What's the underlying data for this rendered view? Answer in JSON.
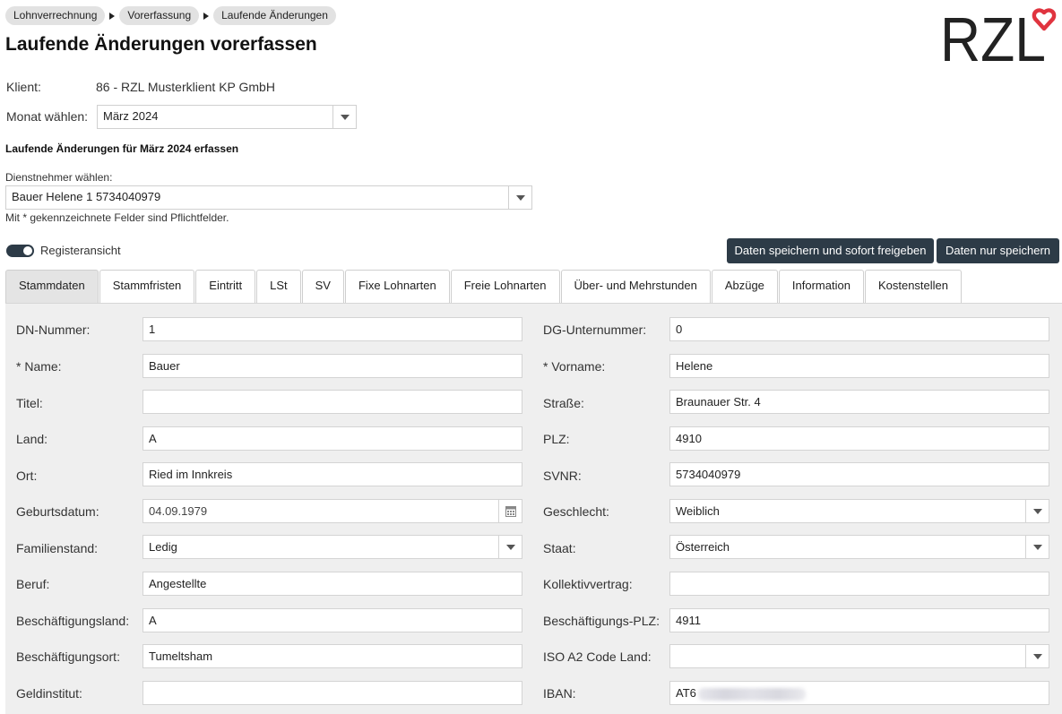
{
  "breadcrumb": [
    "Lohnverrechnung",
    "Vorerfassung",
    "Laufende Änderungen"
  ],
  "page_title": "Laufende Änderungen vorerfassen",
  "logo_text": "RZL",
  "client": {
    "label": "Klient:",
    "value": "86 - RZL Musterklient KP GmbH"
  },
  "month": {
    "label": "Monat wählen:",
    "value": "März 2024"
  },
  "section_heading": "Laufende Änderungen für März 2024 erfassen",
  "employee": {
    "label": "Dienstnehmer wählen:",
    "value": "Bauer Helene 1 5734040979"
  },
  "required_note": "Mit * gekennzeichnete Felder sind Pflichtfelder.",
  "register_toggle": {
    "label": "Registeransicht",
    "on": true
  },
  "buttons": {
    "save_release": "Daten speichern und sofort freigeben",
    "save_only": "Daten nur speichern"
  },
  "tabs": [
    "Stammdaten",
    "Stammfristen",
    "Eintritt",
    "LSt",
    "SV",
    "Fixe Lohnarten",
    "Freie Lohnarten",
    "Über- und Mehrstunden",
    "Abzüge",
    "Information",
    "Kostenstellen"
  ],
  "active_tab": "Stammdaten",
  "fields": {
    "dn_nummer": {
      "label": "DN-Nummer:",
      "value": "1"
    },
    "dg_unternummer": {
      "label": "DG-Unternummer:",
      "value": "0"
    },
    "name": {
      "label": "* Name:",
      "value": "Bauer"
    },
    "vorname": {
      "label": "* Vorname:",
      "value": "Helene"
    },
    "titel": {
      "label": "Titel:",
      "value": ""
    },
    "strasse": {
      "label": "Straße:",
      "value": "Braunauer Str. 4"
    },
    "land": {
      "label": "Land:",
      "value": "A"
    },
    "plz": {
      "label": "PLZ:",
      "value": "4910"
    },
    "ort": {
      "label": "Ort:",
      "value": "Ried im Innkreis"
    },
    "svnr": {
      "label": "SVNR:",
      "value": "5734040979"
    },
    "geburtsdatum": {
      "label": "Geburtsdatum:",
      "value": "04.09.1979"
    },
    "geschlecht": {
      "label": "Geschlecht:",
      "value": "Weiblich"
    },
    "familienstand": {
      "label": "Familienstand:",
      "value": "Ledig"
    },
    "staat": {
      "label": "Staat:",
      "value": "Österreich"
    },
    "beruf": {
      "label": "Beruf:",
      "value": "Angestellte"
    },
    "kollektivvertrag": {
      "label": "Kollektivvertrag:",
      "value": ""
    },
    "beschaeftigungsland": {
      "label": "Beschäftigungsland:",
      "value": "A"
    },
    "beschaeftigungs_plz": {
      "label": "Beschäftigungs-PLZ:",
      "value": "4911"
    },
    "beschaeftigungsort": {
      "label": "Beschäftigungsort:",
      "value": "Tumeltsham"
    },
    "iso_code": {
      "label": "ISO A2 Code Land:",
      "value": ""
    },
    "geldinstitut": {
      "label": "Geldinstitut:",
      "value": ""
    },
    "iban": {
      "label": "IBAN:",
      "value": "AT6"
    }
  },
  "colors": {
    "dark_button": "#2d3b47",
    "logo_heart": "#e0343f",
    "panel_bg": "#efefef"
  }
}
